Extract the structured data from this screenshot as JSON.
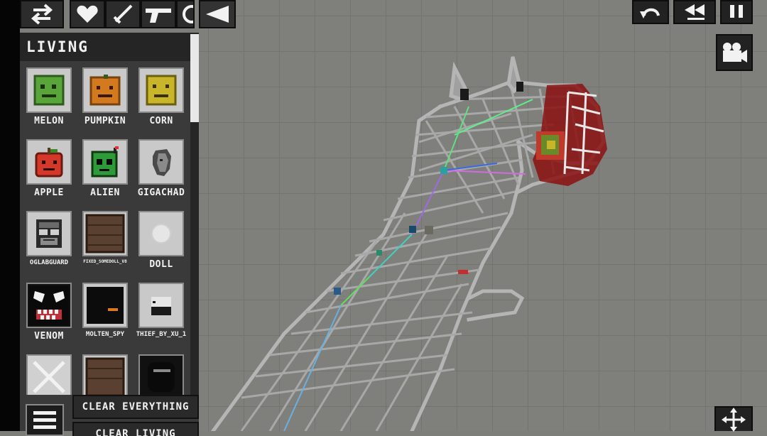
{
  "panel": {
    "category": "LIVING",
    "items": [
      {
        "label": "MELON"
      },
      {
        "label": "PUMPKIN"
      },
      {
        "label": "CORN"
      },
      {
        "label": "APPLE"
      },
      {
        "label": "ALIEN"
      },
      {
        "label": "GIGACHAD"
      },
      {
        "label": "OGLABGUARD"
      },
      {
        "label": "FIXED_SOMEDOLL_V8"
      },
      {
        "label": "DOLL"
      },
      {
        "label": "VENOM"
      },
      {
        "label": "MOLTEN_SPY"
      },
      {
        "label": "THIEF_BY_XU_1"
      },
      {
        "label": ""
      },
      {
        "label": ""
      },
      {
        "label": ""
      }
    ],
    "clear_everything": "CLEAR EVERYTHING",
    "clear_living": "CLEAR LIVING"
  },
  "colors": {
    "melon": "#5aa53a",
    "pumpkin": "#d37a1f",
    "corn": "#c9b52a",
    "apple": "#d4382a",
    "alien": "#2f9a3a",
    "grid": "#7f7f7c",
    "panel": "#3a3a3a"
  },
  "icons": {
    "toolbar": [
      "swap-arrows-icon",
      "heart-icon",
      "sword-icon",
      "gun-icon",
      "wheel-icon",
      "back-triangle-icon"
    ],
    "controls": [
      "undo-icon",
      "rewind-icon",
      "pause-icon",
      "camera-icon",
      "move-arrows-icon"
    ]
  }
}
